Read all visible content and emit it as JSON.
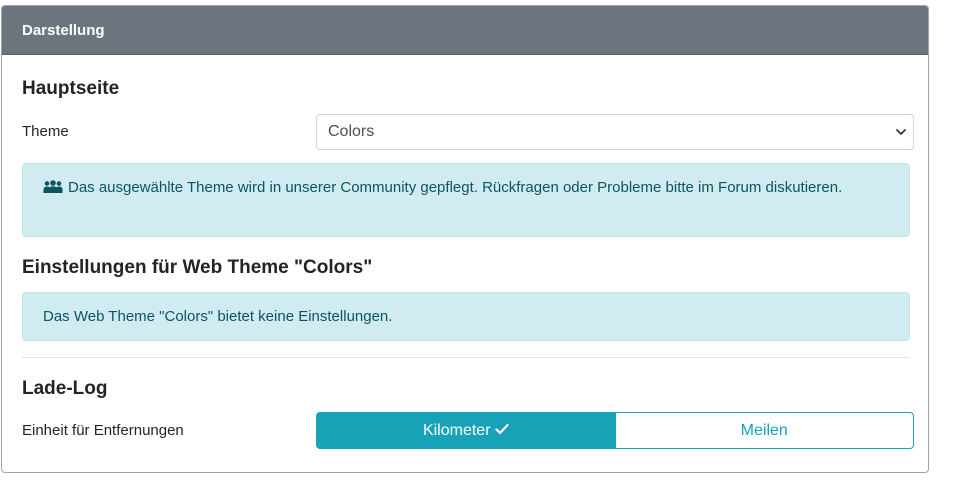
{
  "card": {
    "title": "Darstellung"
  },
  "main_page": {
    "heading": "Hauptseite",
    "theme_label": "Theme",
    "theme_select": {
      "value": "Colors"
    },
    "community_notice": "Das ausgewählte Theme wird in unserer Community gepflegt. Rückfragen oder Probleme bitte im Forum diskutieren."
  },
  "theme_settings": {
    "heading": "Einstellungen für Web Theme \"Colors\"",
    "notice": "Das Web Theme \"Colors\" bietet keine Einstellungen."
  },
  "charge_log": {
    "heading": "Lade-Log",
    "distance_label": "Einheit für Entfernungen",
    "options": [
      "Kilometer",
      "Meilen"
    ],
    "selected": "Kilometer"
  },
  "colors": {
    "header_bg": "#6c757d",
    "accent": "#17a2b8",
    "alert_bg": "#d1ecf1",
    "alert_text": "#0c5460"
  }
}
